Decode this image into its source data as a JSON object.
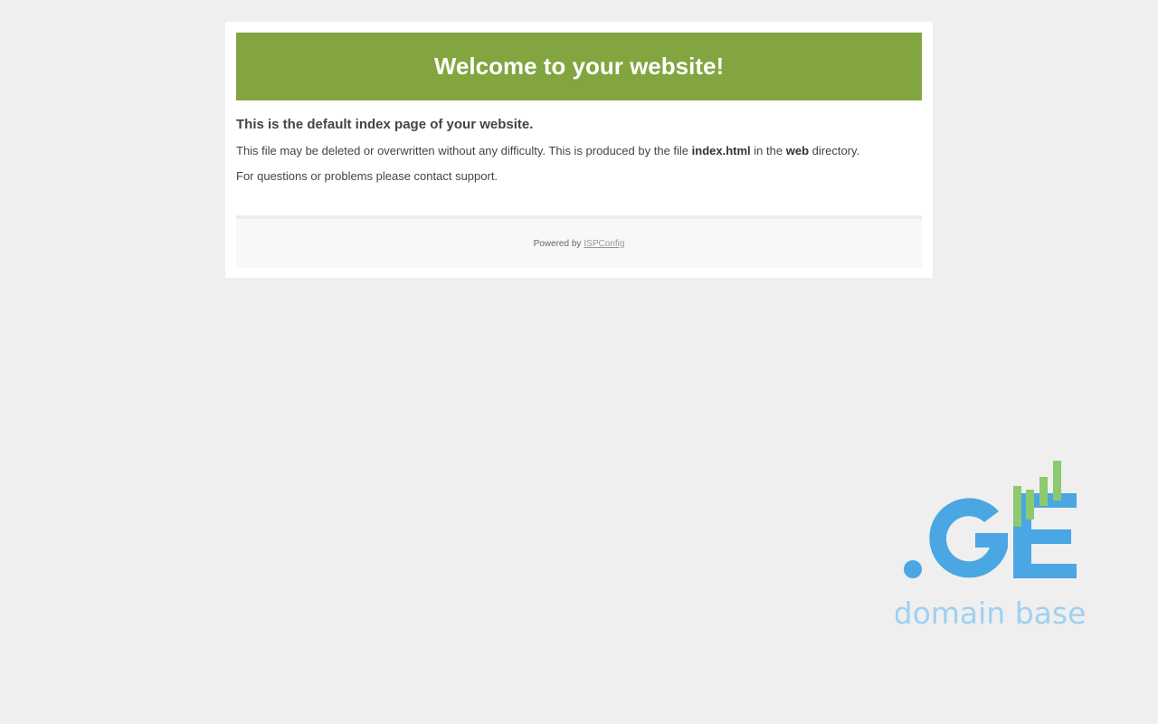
{
  "banner": {
    "title": "Welcome to your website!"
  },
  "content": {
    "headline": "This is the default index page of your website.",
    "desc_pre": "This file may be deleted or overwritten without any difficulty. This is produced by the file",
    "desc_file": "index.html",
    "desc_mid": "in the",
    "desc_dir": "web",
    "desc_post": "directory.",
    "support": "For questions or problems please contact support."
  },
  "footer": {
    "powered_by": "Powered by",
    "link_text": "ISPConfig"
  },
  "logo": {
    "tagline": "domain base",
    "brand_text": ".GE"
  },
  "colors": {
    "banner": "#82a53f",
    "logo_blue": "#4aa7e3",
    "logo_green": "#8dc96e",
    "logo_light_blue": "#9fd0f1"
  }
}
